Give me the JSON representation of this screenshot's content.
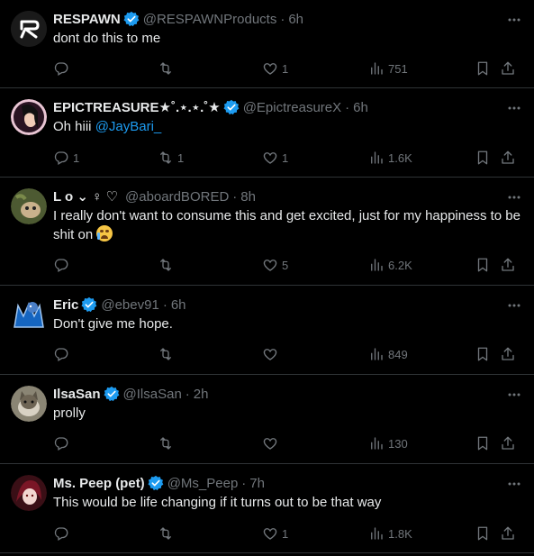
{
  "tweets": [
    {
      "name": "RESPAWN",
      "verified": true,
      "handle": "@RESPAWNProducts",
      "time": "6h",
      "text": "dont do this to me",
      "replies": "",
      "retweets": "",
      "likes": "1",
      "views": "751"
    },
    {
      "name": "EPICTREASURE★˚.⋆.⋆.˚★",
      "verified": true,
      "handle": "@EpictreasureX",
      "time": "6h",
      "text_prefix": "Oh hiii ",
      "mention": "@JayBari_",
      "replies": "1",
      "retweets": "1",
      "likes": "1",
      "views": "1.6K"
    },
    {
      "name": "L o ⌄ ♀ ♡",
      "verified": false,
      "handle": "@aboardBORED",
      "time": "8h",
      "text": "I really don't want to consume this and get excited, just for my happiness to be shit on",
      "emoji": "crying-face",
      "replies": "",
      "retweets": "",
      "likes": "5",
      "views": "6.2K"
    },
    {
      "name": "Eric",
      "verified": true,
      "handle": "@ebev91",
      "time": "6h",
      "text": "Don't give me hope.",
      "replies": "",
      "retweets": "",
      "likes": "",
      "views": "849"
    },
    {
      "name": "IlsaSan",
      "verified": true,
      "handle": "@IlsaSan",
      "time": "2h",
      "text": "prolly",
      "replies": "",
      "retweets": "",
      "likes": "",
      "views": "130"
    },
    {
      "name": "Ms. Peep (pet)",
      "verified": true,
      "handle": "@Ms_Peep",
      "time": "7h",
      "text": "This would be life changing if it turns out to be that way",
      "replies": "",
      "retweets": "",
      "likes": "1",
      "views": "1.8K"
    }
  ],
  "separator": "·",
  "colors": {
    "background": "#000000",
    "text": "#e7e9ea",
    "muted": "#71767b",
    "accent": "#1d9bf0",
    "divider": "#2f3336"
  },
  "icons": [
    "reply-icon",
    "retweet-icon",
    "like-icon",
    "views-icon",
    "bookmark-icon",
    "share-icon",
    "more-icon",
    "verified-badge-icon"
  ]
}
